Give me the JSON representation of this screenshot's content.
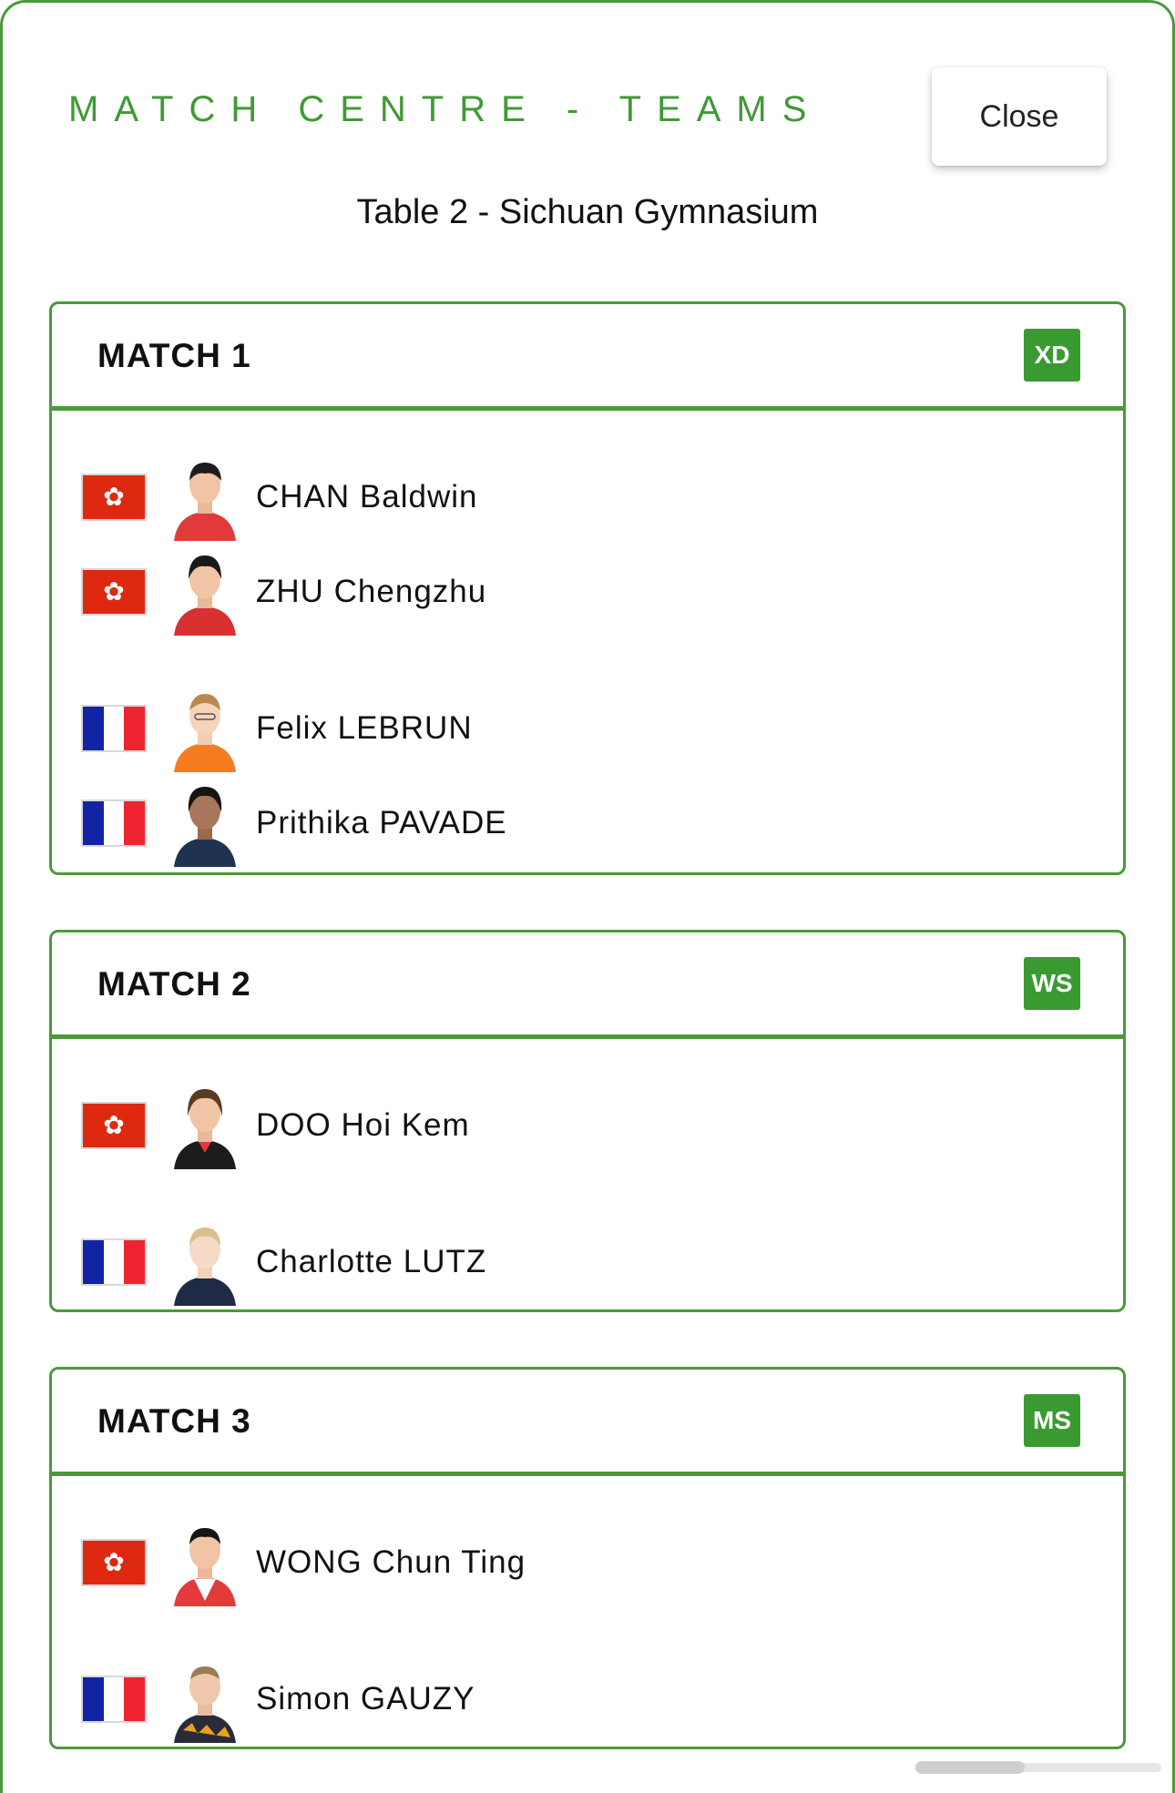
{
  "header": {
    "title": "MATCH CENTRE - TEAMS",
    "close_label": "Close",
    "subtitle": "Table 2 - Sichuan Gymnasium"
  },
  "colors": {
    "accent": "#3f9a33",
    "hk_red": "#de2910",
    "fr_blue": "#1224a6",
    "fr_red": "#ee2430"
  },
  "matches": [
    {
      "title": "MATCH 1",
      "badge": "XD",
      "players": [
        {
          "name": "CHAN Baldwin",
          "flag": "hong-kong-flag"
        },
        {
          "name": "ZHU Chengzhu",
          "flag": "hong-kong-flag"
        },
        {
          "name": "Felix LEBRUN",
          "flag": "france-flag"
        },
        {
          "name": "Prithika PAVADE",
          "flag": "france-flag"
        }
      ]
    },
    {
      "title": "MATCH 2",
      "badge": "WS",
      "players": [
        {
          "name": "DOO Hoi Kem",
          "flag": "hong-kong-flag"
        },
        {
          "name": "Charlotte LUTZ",
          "flag": "france-flag"
        }
      ]
    },
    {
      "title": "MATCH 3",
      "badge": "MS",
      "players": [
        {
          "name": "WONG Chun Ting",
          "flag": "hong-kong-flag"
        },
        {
          "name": "Simon GAUZY",
          "flag": "france-flag"
        }
      ]
    }
  ]
}
